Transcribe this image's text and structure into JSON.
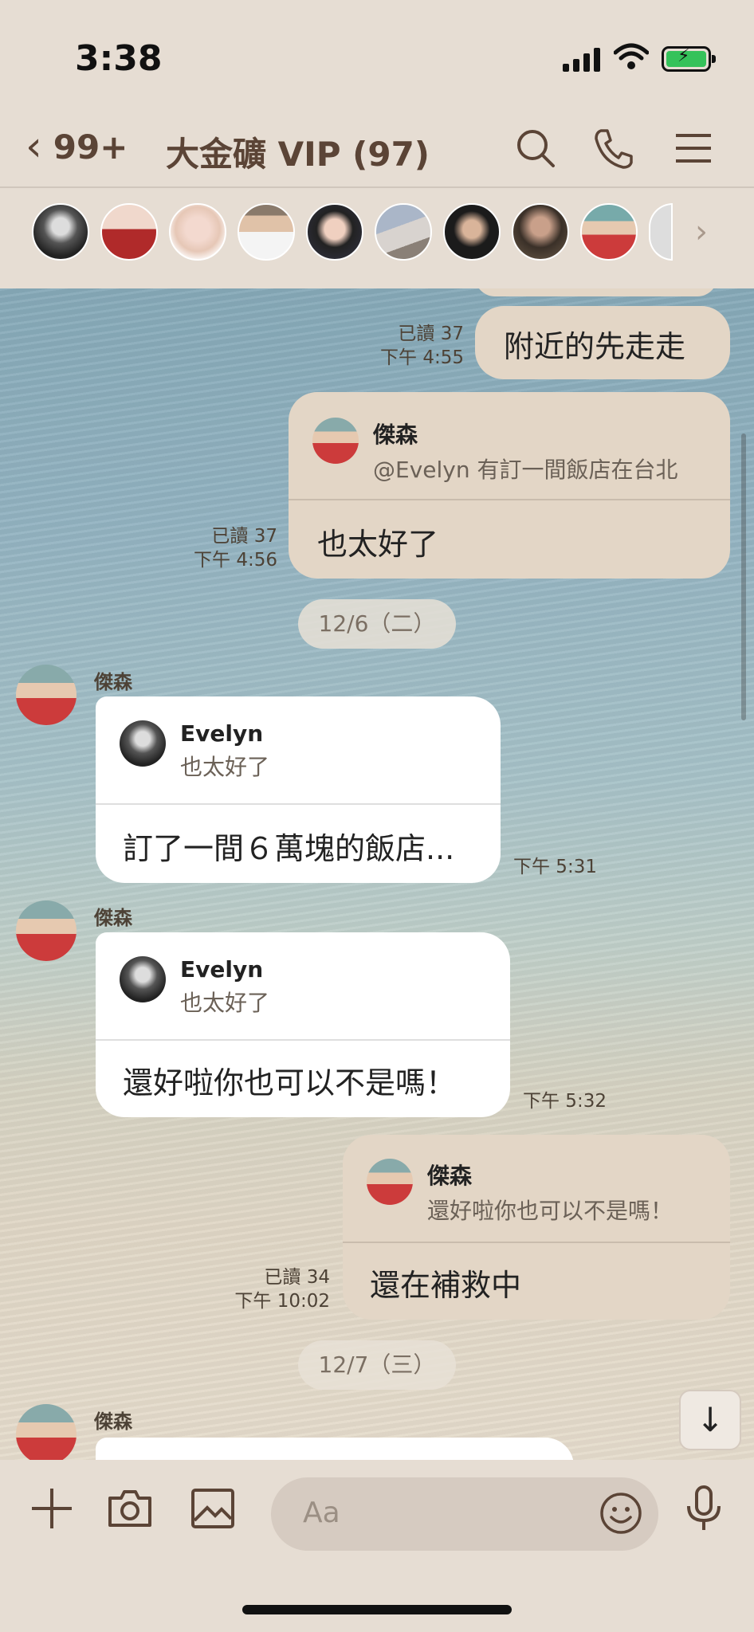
{
  "status_bar": {
    "time": "3:38"
  },
  "header": {
    "back_count": "99+",
    "title": "大金礦 VIP (97)",
    "icons": [
      "search-icon",
      "phone-icon",
      "menu-icon"
    ]
  },
  "members_row": {
    "icons": [
      "chevron-right-icon"
    ]
  },
  "messages": [
    {
      "side": "mine",
      "text": "附近的先走走",
      "read": "已讀 37",
      "time": "下午 4:55"
    },
    {
      "side": "mine",
      "reply_name": "傑森",
      "reply_quote": "@Evelyn 有訂一間飯店在台北",
      "text": "也太好了",
      "read": "已讀 37",
      "time": "下午 4:56"
    },
    {
      "type": "date",
      "text": "12/6（二）"
    },
    {
      "side": "theirs",
      "sender": "傑森",
      "reply_name": "Evelyn",
      "reply_quote": "也太好了",
      "text": "訂了一間６萬塊的飯店...",
      "time": "下午 5:31"
    },
    {
      "side": "theirs",
      "sender": "傑森",
      "reply_name": "Evelyn",
      "reply_quote": "也太好了",
      "text": "還好啦你也可以不是嗎！",
      "time": "下午 5:32"
    },
    {
      "side": "mine",
      "reply_name": "傑森",
      "reply_quote": "還好啦你也可以不是嗎！",
      "text": "還在補救中",
      "read": "已讀 34",
      "time": "下午 10:02"
    },
    {
      "type": "date",
      "text": "12/7（三）"
    },
    {
      "side": "theirs",
      "sender": "傑森",
      "text": ""
    }
  ],
  "input_bar": {
    "placeholder": "Aa"
  },
  "colors": {
    "background": "#e6ddd3",
    "my_bubble": "#e3d6c6",
    "their_bubble": "#ffffff",
    "accent": "#5b4436"
  }
}
